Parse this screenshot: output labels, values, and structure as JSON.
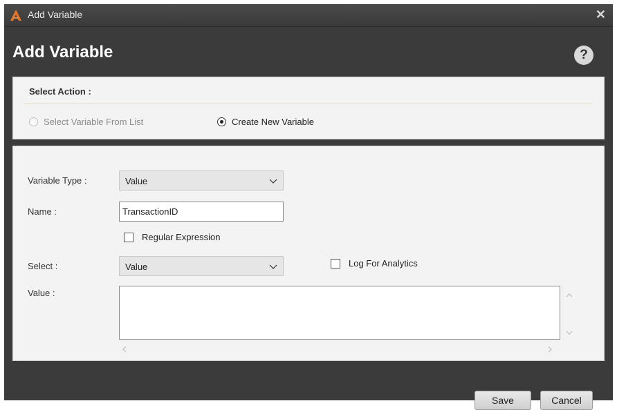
{
  "window": {
    "title": "Add Variable"
  },
  "header": {
    "title": "Add Variable",
    "help_glyph": "?"
  },
  "action": {
    "label": "Select Action :",
    "options": [
      {
        "label": "Select Variable From List",
        "selected": false,
        "enabled": false
      },
      {
        "label": "Create New Variable",
        "selected": true,
        "enabled": true
      }
    ]
  },
  "form": {
    "variable_type": {
      "label": "Variable Type :",
      "value": "Value"
    },
    "name": {
      "label": "Name :",
      "value": "TransactionID"
    },
    "regular_expression": {
      "label": "Regular Expression",
      "checked": false
    },
    "select": {
      "label": "Select :",
      "value": "Value"
    },
    "log_for_analytics": {
      "label": "Log For Analytics",
      "checked": false
    },
    "value": {
      "label": "Value :",
      "value": ""
    }
  },
  "buttons": {
    "save": "Save",
    "cancel": "Cancel"
  },
  "icons": {
    "app": "app-logo-icon",
    "close": "close-icon",
    "help": "help-icon",
    "dropdown": "chevron-down-icon"
  },
  "colors": {
    "titlebar": "#3a3a3a",
    "dialog_background": "#3b3b3b",
    "panel_background": "#f3f3f3",
    "app_icon": "#e8752a"
  }
}
